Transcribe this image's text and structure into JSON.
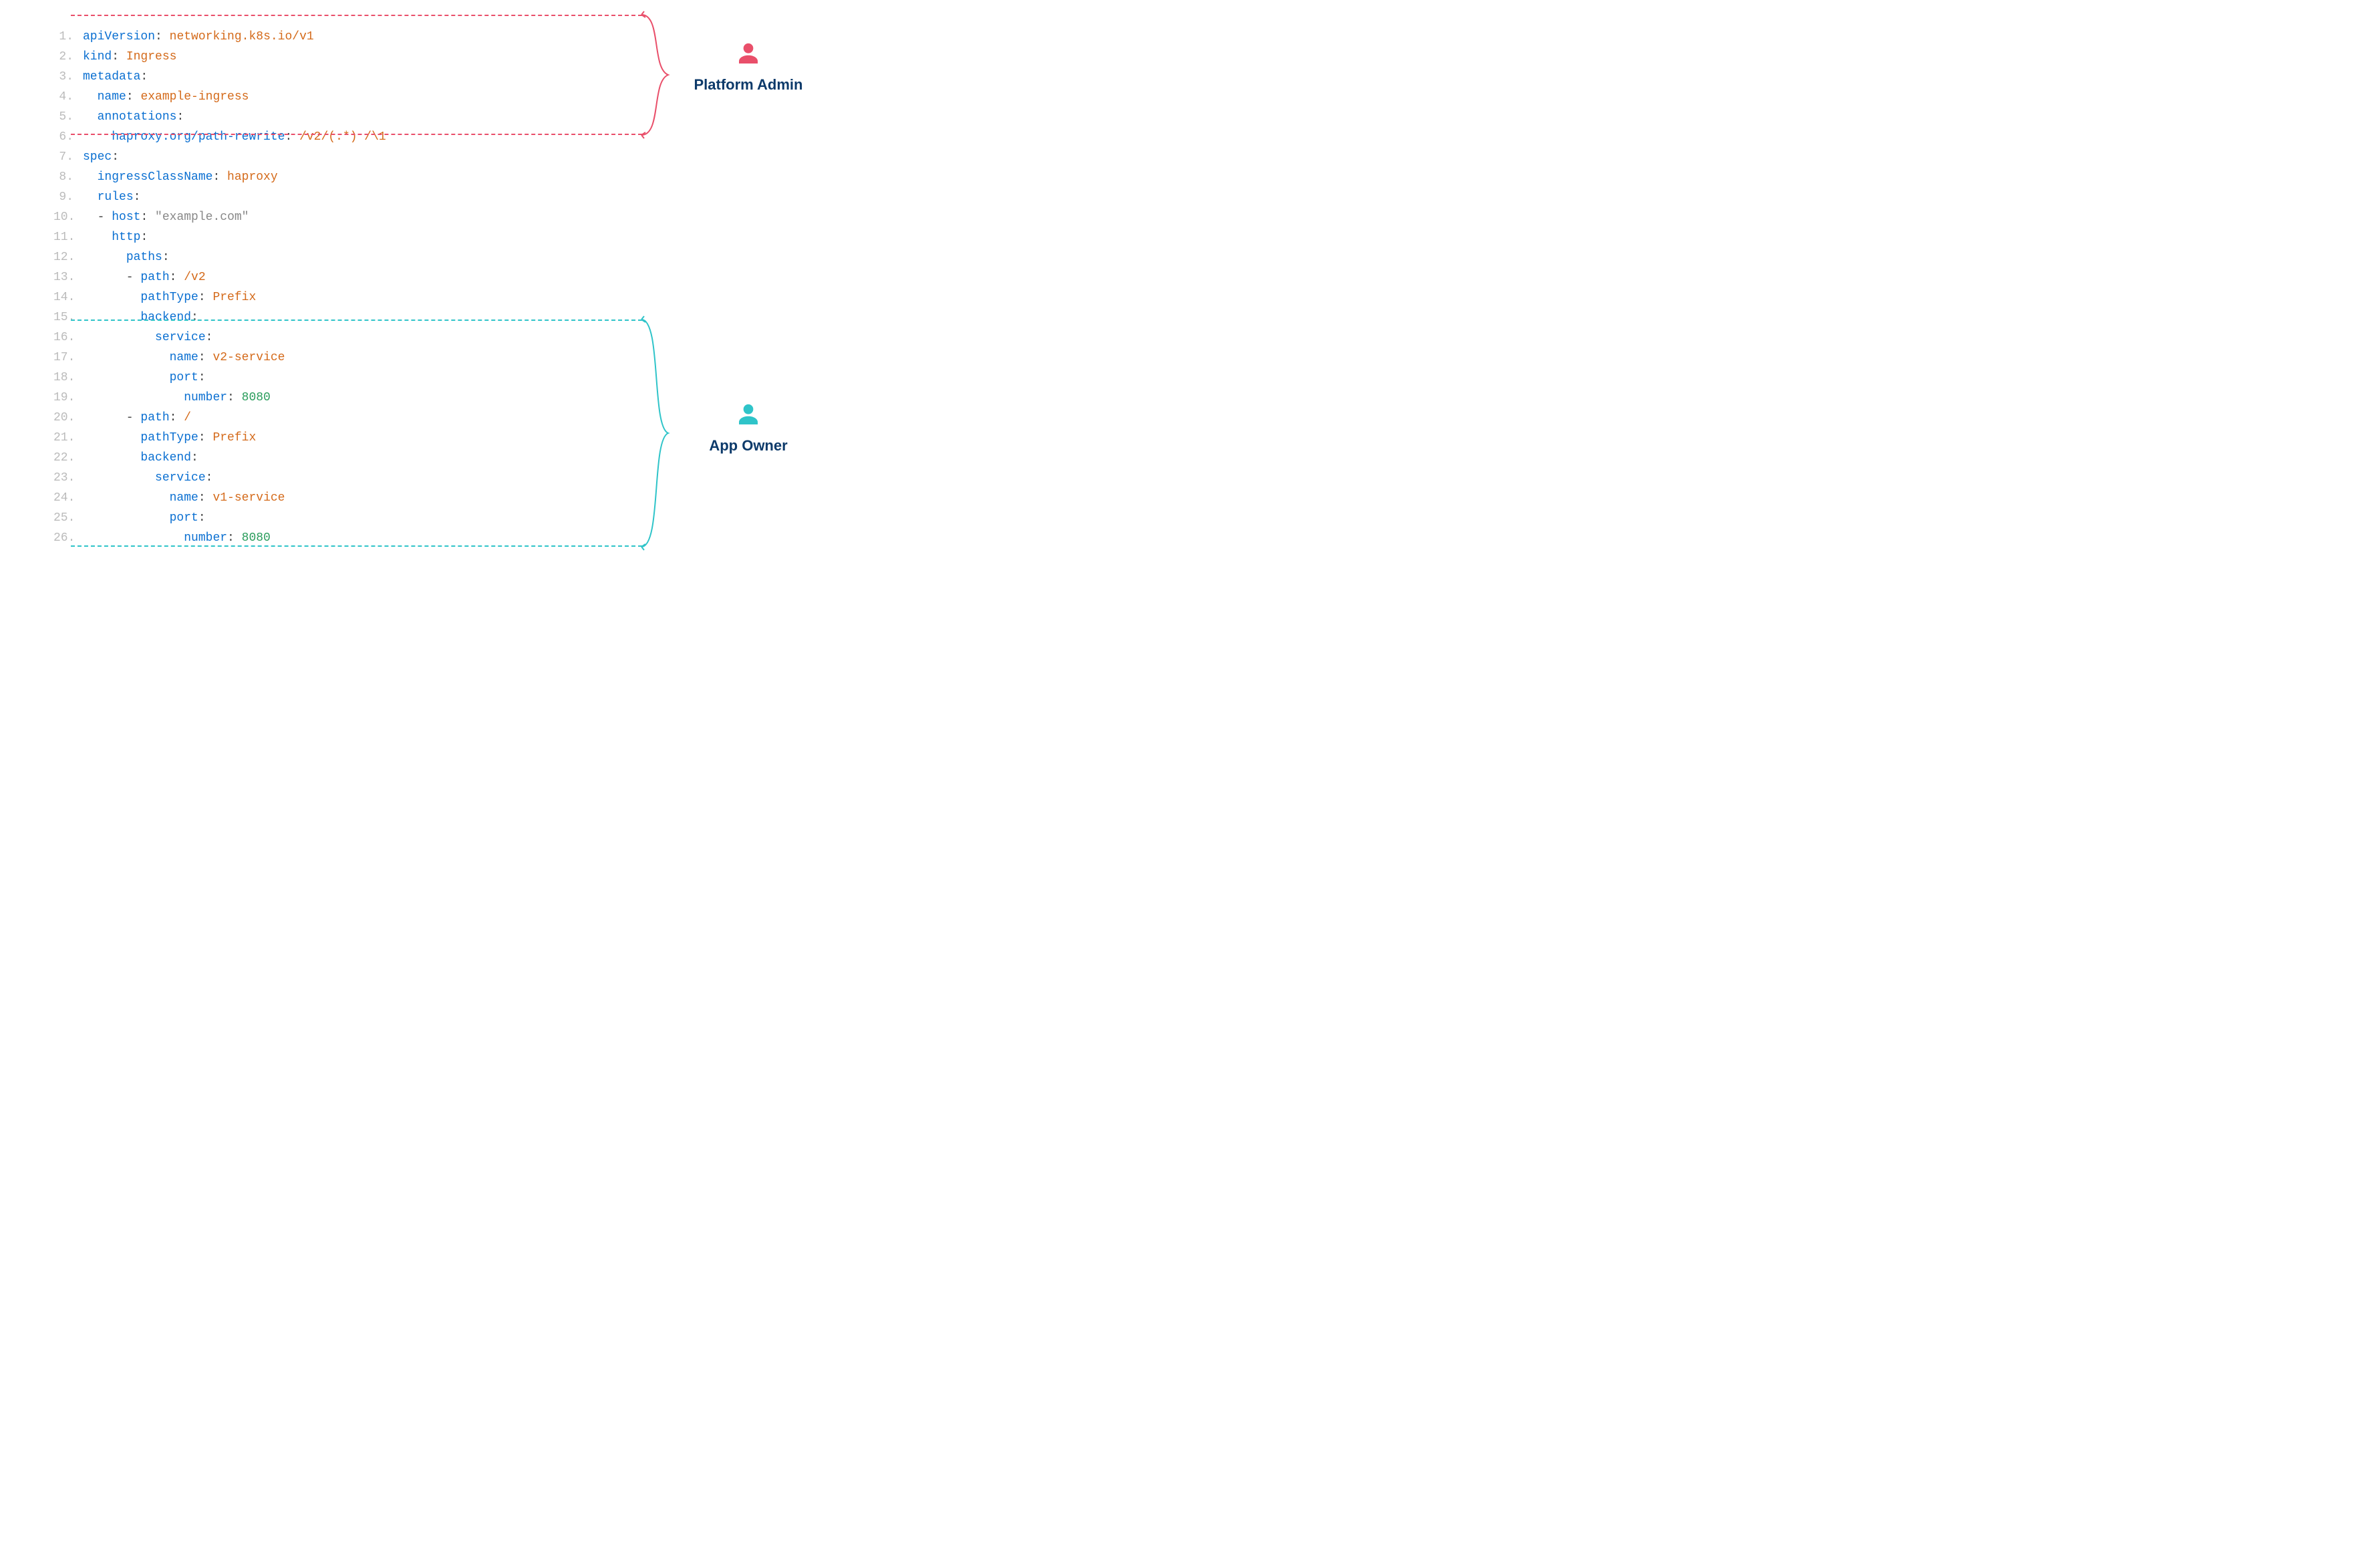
{
  "colors": {
    "top_region": "#e94f6a",
    "bottom_region": "#2fc4c9",
    "key": "#0a6fd1",
    "value": "#d46a1a",
    "number": "#2a9d5c",
    "label": "#0d3a6a"
  },
  "personas": {
    "top": {
      "label": "Platform Admin",
      "icon": "person-icon",
      "color": "#e94f6a"
    },
    "bottom": {
      "label": "App Owner",
      "icon": "person-icon",
      "color": "#2fc4c9"
    }
  },
  "code": {
    "lines": [
      {
        "n": "1.",
        "tokens": [
          [
            "k",
            "apiVersion"
          ],
          [
            "p",
            ": "
          ],
          [
            "v",
            "networking.k8s.io/v1"
          ]
        ]
      },
      {
        "n": "2.",
        "tokens": [
          [
            "k",
            "kind"
          ],
          [
            "p",
            ": "
          ],
          [
            "v",
            "Ingress"
          ]
        ]
      },
      {
        "n": "3.",
        "tokens": [
          [
            "k",
            "metadata"
          ],
          [
            "p",
            ":"
          ]
        ]
      },
      {
        "n": "4.",
        "tokens": [
          [
            "p",
            "  "
          ],
          [
            "k",
            "name"
          ],
          [
            "p",
            ": "
          ],
          [
            "v",
            "example-ingress"
          ]
        ]
      },
      {
        "n": "5.",
        "tokens": [
          [
            "p",
            "  "
          ],
          [
            "k",
            "annotations"
          ],
          [
            "p",
            ":"
          ]
        ]
      },
      {
        "n": "6.",
        "tokens": [
          [
            "p",
            "    "
          ],
          [
            "k",
            "haproxy.org/path-rewrite"
          ],
          [
            "p",
            ": "
          ],
          [
            "v",
            "/v2/(.*) /\\1"
          ]
        ]
      },
      {
        "n": "7.",
        "tokens": [
          [
            "k",
            "spec"
          ],
          [
            "p",
            ":"
          ]
        ]
      },
      {
        "n": "8.",
        "tokens": [
          [
            "p",
            "  "
          ],
          [
            "k",
            "ingressClassName"
          ],
          [
            "p",
            ": "
          ],
          [
            "v",
            "haproxy"
          ]
        ]
      },
      {
        "n": "9.",
        "tokens": [
          [
            "p",
            "  "
          ],
          [
            "k",
            "rules"
          ],
          [
            "p",
            ":"
          ]
        ]
      },
      {
        "n": "10.",
        "tokens": [
          [
            "p",
            "  - "
          ],
          [
            "k",
            "host"
          ],
          [
            "p",
            ": "
          ],
          [
            "s",
            "\"example.com\""
          ]
        ]
      },
      {
        "n": "11.",
        "tokens": [
          [
            "p",
            "    "
          ],
          [
            "k",
            "http"
          ],
          [
            "p",
            ":"
          ]
        ]
      },
      {
        "n": "12.",
        "tokens": [
          [
            "p",
            "      "
          ],
          [
            "k",
            "paths"
          ],
          [
            "p",
            ":"
          ]
        ]
      },
      {
        "n": "13.",
        "tokens": [
          [
            "p",
            "      - "
          ],
          [
            "k",
            "path"
          ],
          [
            "p",
            ": "
          ],
          [
            "v",
            "/v2"
          ]
        ]
      },
      {
        "n": "14.",
        "tokens": [
          [
            "p",
            "        "
          ],
          [
            "k",
            "pathType"
          ],
          [
            "p",
            ": "
          ],
          [
            "v",
            "Prefix"
          ]
        ]
      },
      {
        "n": "15.",
        "tokens": [
          [
            "p",
            "        "
          ],
          [
            "k",
            "backend"
          ],
          [
            "p",
            ":"
          ]
        ]
      },
      {
        "n": "16.",
        "tokens": [
          [
            "p",
            "          "
          ],
          [
            "k",
            "service"
          ],
          [
            "p",
            ":"
          ]
        ]
      },
      {
        "n": "17.",
        "tokens": [
          [
            "p",
            "            "
          ],
          [
            "k",
            "name"
          ],
          [
            "p",
            ": "
          ],
          [
            "v",
            "v2-service"
          ]
        ]
      },
      {
        "n": "18.",
        "tokens": [
          [
            "p",
            "            "
          ],
          [
            "k",
            "port"
          ],
          [
            "p",
            ":"
          ]
        ]
      },
      {
        "n": "19.",
        "tokens": [
          [
            "p",
            "              "
          ],
          [
            "k",
            "number"
          ],
          [
            "p",
            ": "
          ],
          [
            "g",
            "8080"
          ]
        ]
      },
      {
        "n": "20.",
        "tokens": [
          [
            "p",
            "      - "
          ],
          [
            "k",
            "path"
          ],
          [
            "p",
            ": "
          ],
          [
            "v",
            "/"
          ]
        ]
      },
      {
        "n": "21.",
        "tokens": [
          [
            "p",
            "        "
          ],
          [
            "k",
            "pathType"
          ],
          [
            "p",
            ": "
          ],
          [
            "v",
            "Prefix"
          ]
        ]
      },
      {
        "n": "22.",
        "tokens": [
          [
            "p",
            "        "
          ],
          [
            "k",
            "backend"
          ],
          [
            "p",
            ":"
          ]
        ]
      },
      {
        "n": "23.",
        "tokens": [
          [
            "p",
            "          "
          ],
          [
            "k",
            "service"
          ],
          [
            "p",
            ":"
          ]
        ]
      },
      {
        "n": "24.",
        "tokens": [
          [
            "p",
            "            "
          ],
          [
            "k",
            "name"
          ],
          [
            "p",
            ": "
          ],
          [
            "v",
            "v1-service"
          ]
        ]
      },
      {
        "n": "25.",
        "tokens": [
          [
            "p",
            "            "
          ],
          [
            "k",
            "port"
          ],
          [
            "p",
            ":"
          ]
        ]
      },
      {
        "n": "26.",
        "tokens": [
          [
            "p",
            "              "
          ],
          [
            "k",
            "number"
          ],
          [
            "p",
            ": "
          ],
          [
            "g",
            "8080"
          ]
        ]
      }
    ]
  }
}
